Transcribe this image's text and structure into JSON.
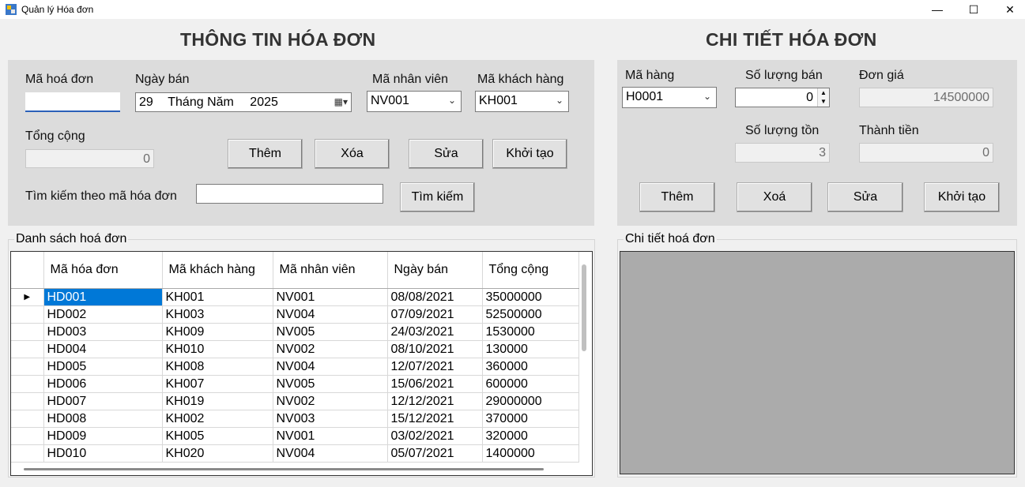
{
  "window": {
    "title": "Quản lý Hóa đơn",
    "minimize": "—",
    "maximize": "☐",
    "close": "✕"
  },
  "invoice": {
    "heading": "THÔNG TIN HÓA ĐƠN",
    "ma_hoa_don_label": "Mã hoá đơn",
    "ma_hoa_don_value": "",
    "ngay_ban_label": "Ngày bán",
    "ngay_ban_day": "29",
    "ngay_ban_month": "Tháng Năm",
    "ngay_ban_year": "2025",
    "ma_nhan_vien_label": "Mã nhân viên",
    "ma_nhan_vien_value": "NV001",
    "ma_khach_hang_label": "Mã khách hàng",
    "ma_khach_hang_value": "KH001",
    "tong_cong_label": "Tổng cộng",
    "tong_cong_value": "0",
    "btn_them": "Thêm",
    "btn_xoa": "Xóa",
    "btn_sua": "Sửa",
    "btn_khoi_tao": "Khởi tạo",
    "search_label": "Tìm kiếm theo mã hóa đơn",
    "search_value": "",
    "btn_tim_kiem": "Tìm kiếm"
  },
  "detail": {
    "heading": "CHI TIẾT HÓA ĐƠN",
    "ma_hang_label": "Mã hàng",
    "ma_hang_value": "H0001",
    "so_luong_ban_label": "Số lượng bán",
    "so_luong_ban_value": "0",
    "don_gia_label": "Đơn giá",
    "don_gia_value": "14500000",
    "so_luong_ton_label": "Số lượng tồn",
    "so_luong_ton_value": "3",
    "thanh_tien_label": "Thành tiền",
    "thanh_tien_value": "0",
    "btn_them": "Thêm",
    "btn_xoa": "Xoá",
    "btn_sua": "Sửa",
    "btn_khoi_tao": "Khởi tạo"
  },
  "invoice_list": {
    "group_label": "Danh sách hoá đơn",
    "columns": [
      "Mã hóa đơn",
      "Mã khách hàng",
      "Mã nhân viên",
      "Ngày bán",
      "Tổng cộng"
    ],
    "rows": [
      [
        "HD001",
        "KH001",
        "NV001",
        "08/08/2021",
        "35000000"
      ],
      [
        "HD002",
        "KH003",
        "NV004",
        "07/09/2021",
        "52500000"
      ],
      [
        "HD003",
        "KH009",
        "NV005",
        "24/03/2021",
        "1530000"
      ],
      [
        "HD004",
        "KH010",
        "NV002",
        "08/10/2021",
        "130000"
      ],
      [
        "HD005",
        "KH008",
        "NV004",
        "12/07/2021",
        "360000"
      ],
      [
        "HD006",
        "KH007",
        "NV005",
        "15/06/2021",
        "600000"
      ],
      [
        "HD007",
        "KH019",
        "NV002",
        "12/12/2021",
        "29000000"
      ],
      [
        "HD008",
        "KH002",
        "NV003",
        "15/12/2021",
        "370000"
      ],
      [
        "HD009",
        "KH005",
        "NV001",
        "03/02/2021",
        "320000"
      ],
      [
        "HD010",
        "KH020",
        "NV004",
        "05/07/2021",
        "1400000"
      ]
    ],
    "current_row_marker": "▶"
  },
  "detail_list": {
    "group_label": "Chi tiết hoá đơn"
  }
}
